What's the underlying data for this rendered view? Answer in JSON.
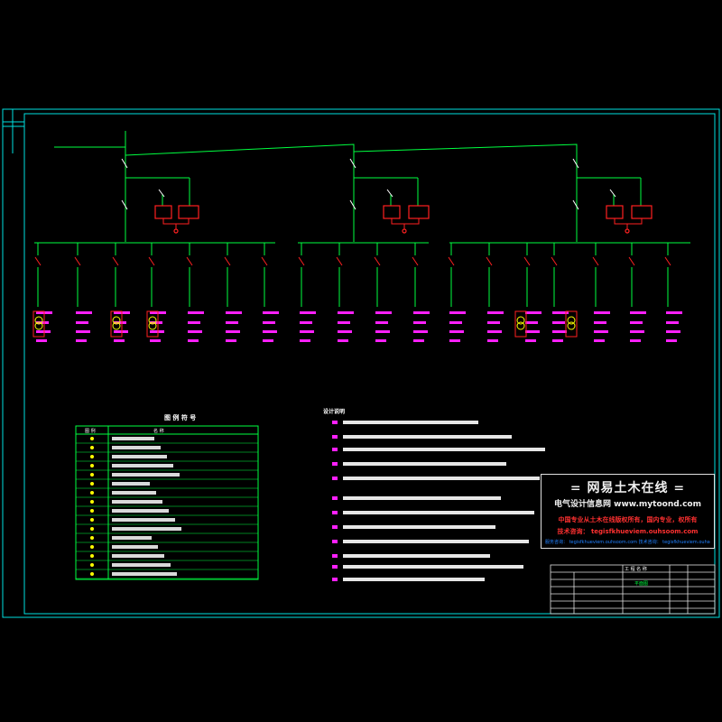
{
  "legend": {
    "title": "图 例 符 号",
    "headers": [
      "图 例",
      "名 称"
    ]
  },
  "notes": {
    "title": "设计说明"
  },
  "title_block": {
    "project_label": "工 程 名 称",
    "drawing_name": "平面图"
  },
  "stamp": {
    "line1": "= 网易土木在线 =",
    "line2": "电气设计信息网 www.mytoond.com",
    "line3": "中国专业从土木在线版权所有，国内专业，权所有",
    "line4": "技术咨询： tegisfkhueviem.ouhsoom.com",
    "line5": "服务咨询： tegisfkhueviem.ouhsoom.com  技术咨询： tegisfkhueviem.ouhsoom.com"
  },
  "colors": {
    "background": "#000000",
    "frame": "#00e0e0",
    "wire": "#00ff40",
    "text": "#ffffff",
    "accent": "#ff20ff",
    "alarm": "#ff2020",
    "highlight": "#ffff00"
  }
}
